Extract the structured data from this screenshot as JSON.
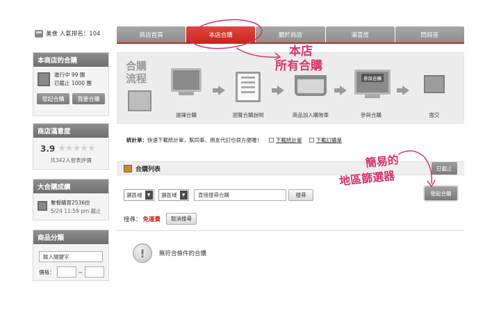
{
  "rank": {
    "label": "美食 人氣排名：104"
  },
  "tabs": [
    {
      "label": "商店首頁"
    },
    {
      "label": "本店合購"
    },
    {
      "label": "關於商店"
    },
    {
      "label": "滿意度"
    },
    {
      "label": "問與答"
    }
  ],
  "sidebar": {
    "group_buy": {
      "title": "本商店的合購",
      "ongoing": "進行中 99 團",
      "ended": "已截止 1000 團",
      "start_btn": "發起合購",
      "want_btn": "我要合購"
    },
    "satisfaction": {
      "title": "商店滿意度",
      "score": "3.9",
      "reviews": "共342人發表評價"
    },
    "success": {
      "title": "大合購成績",
      "item": "聚餐購買2536份",
      "date": "5/24 11:59 pm 截止"
    },
    "category": {
      "title": "商品分類",
      "keyword_placeholder": "輸入關鍵字",
      "price_label": "價格：",
      "price_sep": "~"
    }
  },
  "process": {
    "title_line1": "合購",
    "title_line2": "流程",
    "steps": [
      {
        "label": "選擇合購"
      },
      {
        "label": "瀏覽合購說明"
      },
      {
        "label": "商品加入購物車"
      },
      {
        "label": "參與合購"
      },
      {
        "label": "面交"
      }
    ],
    "join_badge": "參與合購"
  },
  "info": {
    "calc_label": "統計單：",
    "calc_desc": "快速下載統計單，幫同事、朋友代訂也很方便喔！",
    "download_stat": "下載統計單",
    "download_order": "下載訂購單"
  },
  "list": {
    "title": "合購列表",
    "closed_btn": "已截止",
    "region1": "選區域",
    "region2": "選區域",
    "search_placeholder": "直接搜尋合購",
    "search_btn": "搜尋",
    "start_btn": "發起合購",
    "filter_label": "搜尋：",
    "filter_value": "免運費",
    "cancel_btn": "取消搜尋",
    "empty": "無符合條件的合購"
  },
  "annotations": {
    "a1_line1": "本店",
    "a1_line2": "所有合購",
    "a2_line1": "簡易的",
    "a2_line2": "地區篩選器"
  },
  "colors": {
    "accent": "#c8261c",
    "handwriting": "#d7336f"
  }
}
